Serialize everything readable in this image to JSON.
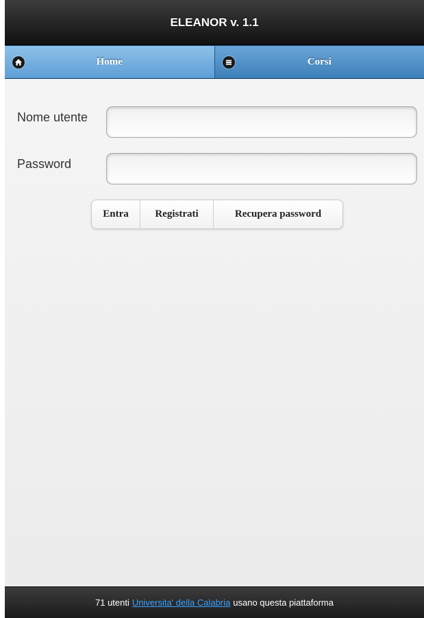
{
  "header": {
    "title": "ELEANOR v. 1.1"
  },
  "navbar": {
    "items": [
      {
        "label": "Home",
        "icon": "home-icon"
      },
      {
        "label": "Corsi",
        "icon": "list-icon"
      }
    ]
  },
  "form": {
    "username_label": "Nome utente",
    "username_value": "",
    "password_label": "Password",
    "password_value": ""
  },
  "buttons": {
    "login": "Entra",
    "register": "Registrati",
    "recover": "Recupera password"
  },
  "footer": {
    "prefix": "71 utenti",
    "link": "Universita' della Calabria",
    "suffix": "usano questa piattaforma"
  },
  "colors": {
    "header_bg": "#1f1f1f",
    "nav_blue": "#5f9ed5",
    "link": "#3aa2ff"
  }
}
